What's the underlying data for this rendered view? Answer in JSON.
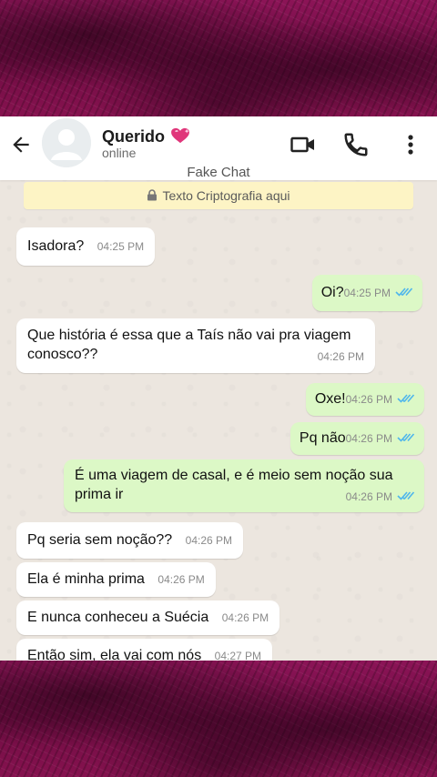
{
  "header": {
    "contact_name": "Querido",
    "status": "online",
    "heart_icon": "sparkling-heart-icon"
  },
  "subtitle": "Fake Chat",
  "encryption_banner": "Texto Criptografia aqui",
  "colors": {
    "outgoing_bubble": "#dcf8c6",
    "incoming_bubble": "#ffffff",
    "read_ticks": "#4fb6ec",
    "banner": "#fdf4c5",
    "frame": "#7a0f4a"
  },
  "messages": [
    {
      "direction": "in",
      "text": "Isadora?",
      "time": "04:25 PM"
    },
    {
      "direction": "out",
      "text": "Oi?",
      "time": "04:25 PM",
      "read": true
    },
    {
      "direction": "in",
      "text": "Que história é essa que a Taís não vai pra viagem conosco??",
      "time": "04:26 PM"
    },
    {
      "direction": "out",
      "text": "Oxe!",
      "time": "04:26 PM",
      "read": true
    },
    {
      "direction": "out",
      "text": "Pq não",
      "time": "04:26 PM",
      "read": true
    },
    {
      "direction": "out",
      "text": "É uma viagem de casal, e é meio sem noção sua prima ir",
      "time": "04:26 PM",
      "read": true
    },
    {
      "direction": "in",
      "text": "Pq seria sem noção??",
      "time": "04:26 PM"
    },
    {
      "direction": "in",
      "text": "Ela é minha prima",
      "time": "04:26 PM"
    },
    {
      "direction": "in",
      "text": "E nunca conheceu a Suécia",
      "time": "04:26 PM"
    },
    {
      "direction": "in",
      "text": "Então sim, ela vai com nós",
      "time": "04:27 PM"
    }
  ]
}
